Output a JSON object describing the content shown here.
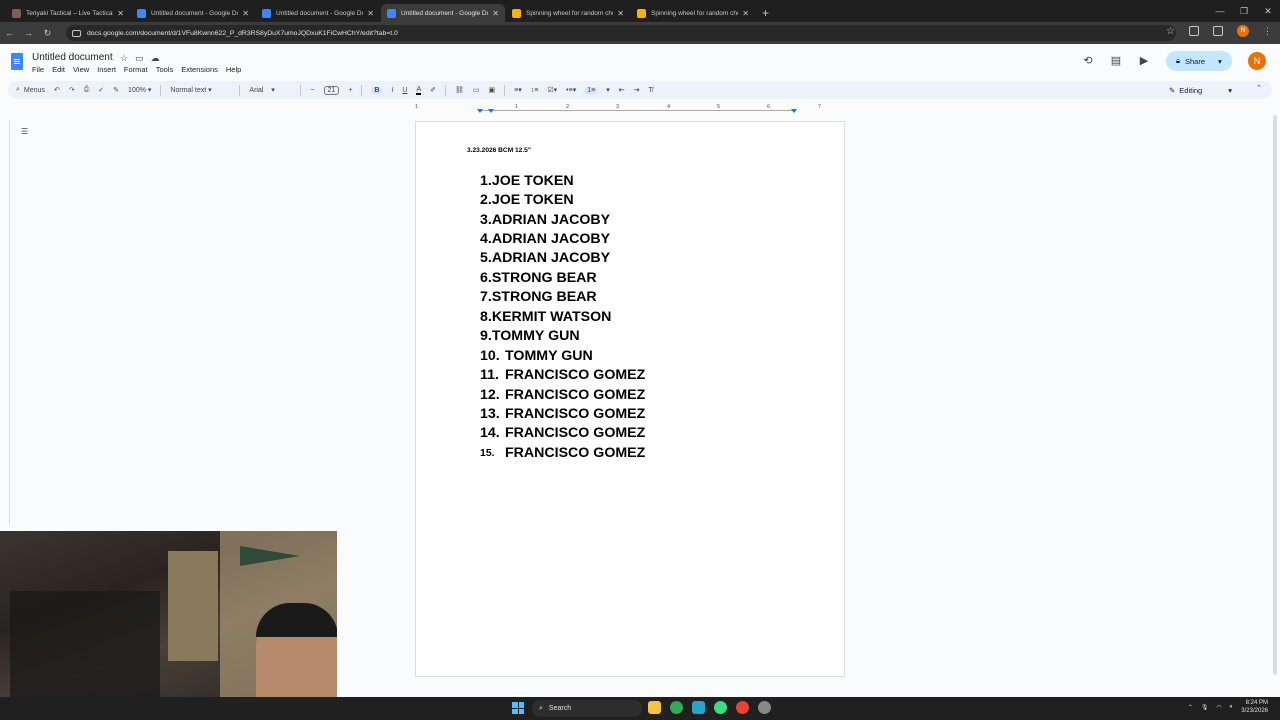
{
  "browser": {
    "tabs": [
      {
        "title": "Teriyaki Tactical – Live Tactical We...",
        "favicon_color": "#7b5e57",
        "active": false
      },
      {
        "title": "Untitled document - Google Docs",
        "favicon_color": "#4285f4",
        "active": false
      },
      {
        "title": "Untitled document - Google Docs",
        "favicon_color": "#4285f4",
        "active": false
      },
      {
        "title": "Untitled document - Google Docs",
        "favicon_color": "#4285f4",
        "active": true
      },
      {
        "title": "Spinning wheel for random choic...",
        "favicon_color": "#f4b400",
        "active": false
      },
      {
        "title": "Spinning wheel for random choic...",
        "favicon_color": "#f4b400",
        "active": false
      }
    ],
    "url": "docs.google.com/document/d/1VFu8Kwnn622_P_dR3RS8yDuX7umoJQDxuK1FiCwHChY/edit?tab=t.0",
    "profile_initial": "N"
  },
  "docs": {
    "title": "Untitled document",
    "menu": [
      "File",
      "Edit",
      "View",
      "Insert",
      "Format",
      "Tools",
      "Extensions",
      "Help"
    ],
    "share_label": "Share",
    "avatar_initial": "N",
    "toolbar": {
      "menus_label": "Menus",
      "zoom": "100%",
      "style": "Normal text",
      "font": "Arial",
      "font_size": "21",
      "mode": "Editing"
    },
    "ruler_numbers": [
      "1",
      "1",
      "2",
      "3",
      "4",
      "5",
      "6",
      "7"
    ]
  },
  "document": {
    "heading": "3.23.2026 BCM 12.5\"",
    "entries": [
      {
        "num": "1.",
        "name": "JOE TOKEN"
      },
      {
        "num": "2.",
        "name": "JOE TOKEN"
      },
      {
        "num": "3.",
        "name": "ADRIAN JACOBY"
      },
      {
        "num": "4.",
        "name": "ADRIAN JACOBY"
      },
      {
        "num": "5.",
        "name": "ADRIAN JACOBY"
      },
      {
        "num": "6.",
        "name": "STRONG BEAR"
      },
      {
        "num": "7.",
        "name": "STRONG BEAR"
      },
      {
        "num": "8.",
        "name": "KERMIT WATSON"
      },
      {
        "num": "9.",
        "name": "TOMMY GUN"
      },
      {
        "num": "10.",
        "name": "TOMMY GUN"
      },
      {
        "num": "11.",
        "name": "FRANCISCO GOMEZ"
      },
      {
        "num": "12.",
        "name": "FRANCISCO GOMEZ"
      },
      {
        "num": "13.",
        "name": "FRANCISCO GOMEZ"
      },
      {
        "num": "14.",
        "name": "FRANCISCO GOMEZ"
      },
      {
        "num": "15.",
        "name": "FRANCISCO GOMEZ"
      }
    ]
  },
  "taskbar": {
    "search_label": "Search",
    "time": "8:24 PM",
    "date": "3/23/2026"
  }
}
